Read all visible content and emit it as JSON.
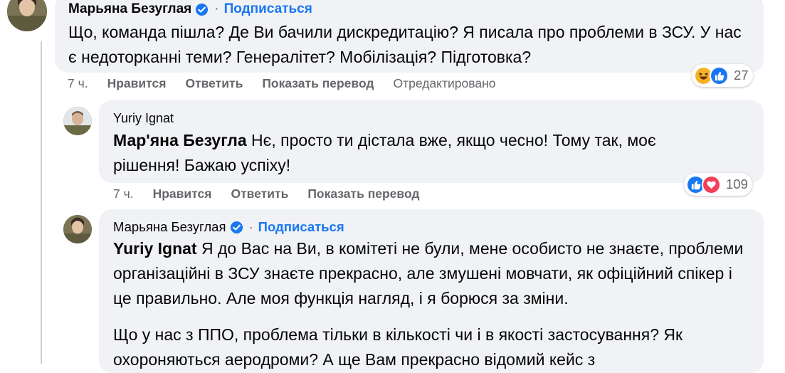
{
  "colors": {
    "link": "#1877f2",
    "bubble": "#f0f2f5",
    "muted": "#65676b",
    "like": "#1877f2",
    "love": "#f33e58",
    "haha": "#f7b125"
  },
  "comments": [
    {
      "author": "Марьяна Безуглая",
      "verified": true,
      "follow_label": "Подписаться",
      "text": "Що, команда пішла? Де Ви бачили дискредитацію? Я писала про проблеми в ЗСУ. У нас є недоторканні теми? Генералітет? Мобілізація? Підготовка?",
      "time": "7 ч.",
      "actions": [
        "Нравится",
        "Ответить",
        "Показать перевод"
      ],
      "edited": "Отредактировано",
      "reactions": {
        "icons": [
          "haha-icon",
          "like-icon"
        ],
        "count": "27"
      }
    },
    {
      "author": "Yuriy Ignat",
      "mention": "Мар'яна Безугла",
      "text": " Нє, просто ти дістала вже, якщо чесно! Тому так, моє рішення! Бажаю успіху!",
      "time": "7 ч.",
      "actions": [
        "Нравится",
        "Ответить",
        "Показать перевод"
      ],
      "reactions": {
        "icons": [
          "like-icon",
          "love-icon"
        ],
        "count": "109"
      }
    },
    {
      "author": "Марьяна Безуглая",
      "verified": true,
      "follow_label": "Подписаться",
      "mention": "Yuriy Ignat",
      "text": " Я до Вас на Ви, в комітеті не були, мене особисто не знаєте, проблеми організаційні в ЗСУ знаєте прекрасно, але змушені мовчати, як офіційний спікер і це правильно. Але моя функція нагляд, і я борюся за зміни.",
      "text2": "Що у нас з ППО, проблема тільки в кількості чи і в якості застосування? Як охороняються аеродроми? А ще Вам прекрасно відомий кейс з"
    }
  ]
}
